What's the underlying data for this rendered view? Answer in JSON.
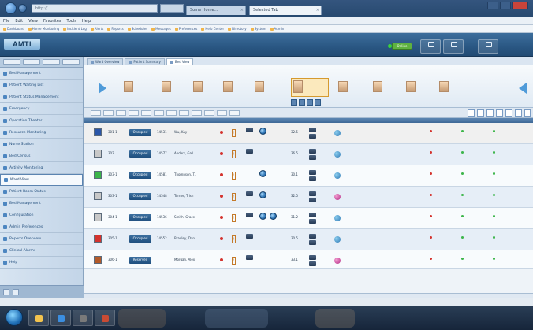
{
  "browser": {
    "address": "http://...",
    "tabs": [
      "Some Home...",
      "Selected Tab"
    ],
    "menu": [
      "File",
      "Edit",
      "View",
      "Favorites",
      "Tools",
      "Help"
    ],
    "favorites": [
      "Dashboard",
      "Home Monitoring",
      "Incident Log",
      "Alerts",
      "Reports",
      "Schedules",
      "Messages",
      "Preferences",
      "Help Center",
      "Directory",
      "System",
      "Admin"
    ]
  },
  "app": {
    "logo": "AMTI",
    "status_label": "Online",
    "header_buttons": [
      "",
      "",
      ""
    ]
  },
  "sidebar": {
    "items": [
      {
        "label": "Bed Management"
      },
      {
        "label": "Patient Waiting List"
      },
      {
        "label": "Patient Status Management"
      },
      {
        "label": "Emergency"
      },
      {
        "label": "Operation Theater"
      },
      {
        "label": "Resource Monitoring"
      },
      {
        "label": "Nurse Station"
      },
      {
        "label": "Bed Census"
      },
      {
        "label": "Activity Monitoring"
      },
      {
        "label": "Ward View",
        "selected": true
      },
      {
        "label": "Patient Room Status"
      },
      {
        "label": "Bed Management"
      },
      {
        "label": "Configuration"
      },
      {
        "label": "Admin Preferences"
      },
      {
        "label": "Reports Overview"
      },
      {
        "label": "Clinical Alarms"
      },
      {
        "label": "Help"
      }
    ],
    "footer_text": ""
  },
  "inner_tabs": [
    "Ward Overview",
    "Patient Summary",
    "Bed View"
  ],
  "carousel": {
    "people": [
      {
        "name": "",
        "sub": ""
      },
      {
        "name": "",
        "sub": ""
      },
      {
        "name": "",
        "sub": ""
      },
      {
        "name": "",
        "sub": ""
      },
      {
        "name": "",
        "sub": ""
      },
      {
        "name": "",
        "sub": ""
      },
      {
        "name": "",
        "sub": ""
      },
      {
        "name": "",
        "sub": ""
      },
      {
        "name": "",
        "sub": ""
      },
      {
        "name": "",
        "sub": ""
      }
    ]
  },
  "grid": {
    "rows": [
      {
        "color": "#2b56a8",
        "bed": "301-1",
        "badge": "Occupied",
        "id": "14531",
        "name": "Wu, Kay",
        "val1": "",
        "val2": "32.5",
        "dot": "blue",
        "n1": "",
        "n2": "",
        "n3": "",
        "n4": "",
        "stats": [
          "",
          "",
          ""
        ],
        "bars": 1,
        "globes": 1
      },
      {
        "color": "#c8c8c8",
        "bed": "302",
        "badge": "Occupied",
        "id": "14577",
        "name": "Anders, Gail",
        "val1": "",
        "val2": "36.5",
        "dot": "blue",
        "n1": "",
        "n2": "",
        "n3": "",
        "n4": "",
        "stats": [
          "",
          "",
          ""
        ],
        "bars": 1,
        "globes": 0
      },
      {
        "color": "#3cb54a",
        "bed": "303-1",
        "badge": "Occupied",
        "id": "14581",
        "name": "Thompson, T.",
        "val1": "",
        "val2": "30.1",
        "dot": "blue",
        "n1": "",
        "n2": "",
        "n3": "",
        "n4": "",
        "stats": [
          "",
          "",
          ""
        ],
        "bars": 0,
        "globes": 1
      },
      {
        "color": "#c8c8c8",
        "bed": "303-1",
        "badge": "Occupied",
        "id": "14548",
        "name": "Turner, Trish",
        "val1": "",
        "val2": "32.5",
        "dot": "pink",
        "n1": "",
        "n2": "",
        "n3": "",
        "n4": "",
        "stats": [
          "",
          "",
          ""
        ],
        "bars": 1,
        "globes": 1
      },
      {
        "color": "#c8c8c8",
        "bed": "304-1",
        "badge": "Occupied",
        "id": "14536",
        "name": "Smith, Grace",
        "val1": "",
        "val2": "31.2",
        "dot": "blue",
        "n1": "",
        "n2": "",
        "n3": "",
        "n4": "",
        "stats": [
          "",
          "",
          ""
        ],
        "bars": 1,
        "globes": 2
      },
      {
        "color": "#d4332e",
        "bed": "305-1",
        "badge": "Occupied",
        "id": "14552",
        "name": "Bradley, Dan",
        "val1": "",
        "val2": "30.5",
        "dot": "blue",
        "n1": "",
        "n2": "",
        "n3": "",
        "n4": "",
        "stats": [
          "",
          "",
          ""
        ],
        "bars": 1,
        "globes": 0
      },
      {
        "color": "#b35a2a",
        "bed": "306-1",
        "badge": "Reserved",
        "id": "",
        "name": "Morgan, Alex",
        "val1": "",
        "val2": "33.1",
        "dot": "pink",
        "n1": "",
        "n2": "",
        "n3": "",
        "n4": "",
        "stats": [
          "",
          "",
          ""
        ],
        "bars": 1,
        "globes": 0
      }
    ],
    "footer": ""
  },
  "statusbar": {
    "left": "",
    "right": ""
  },
  "taskbar": {
    "clock": "",
    "date": ""
  }
}
